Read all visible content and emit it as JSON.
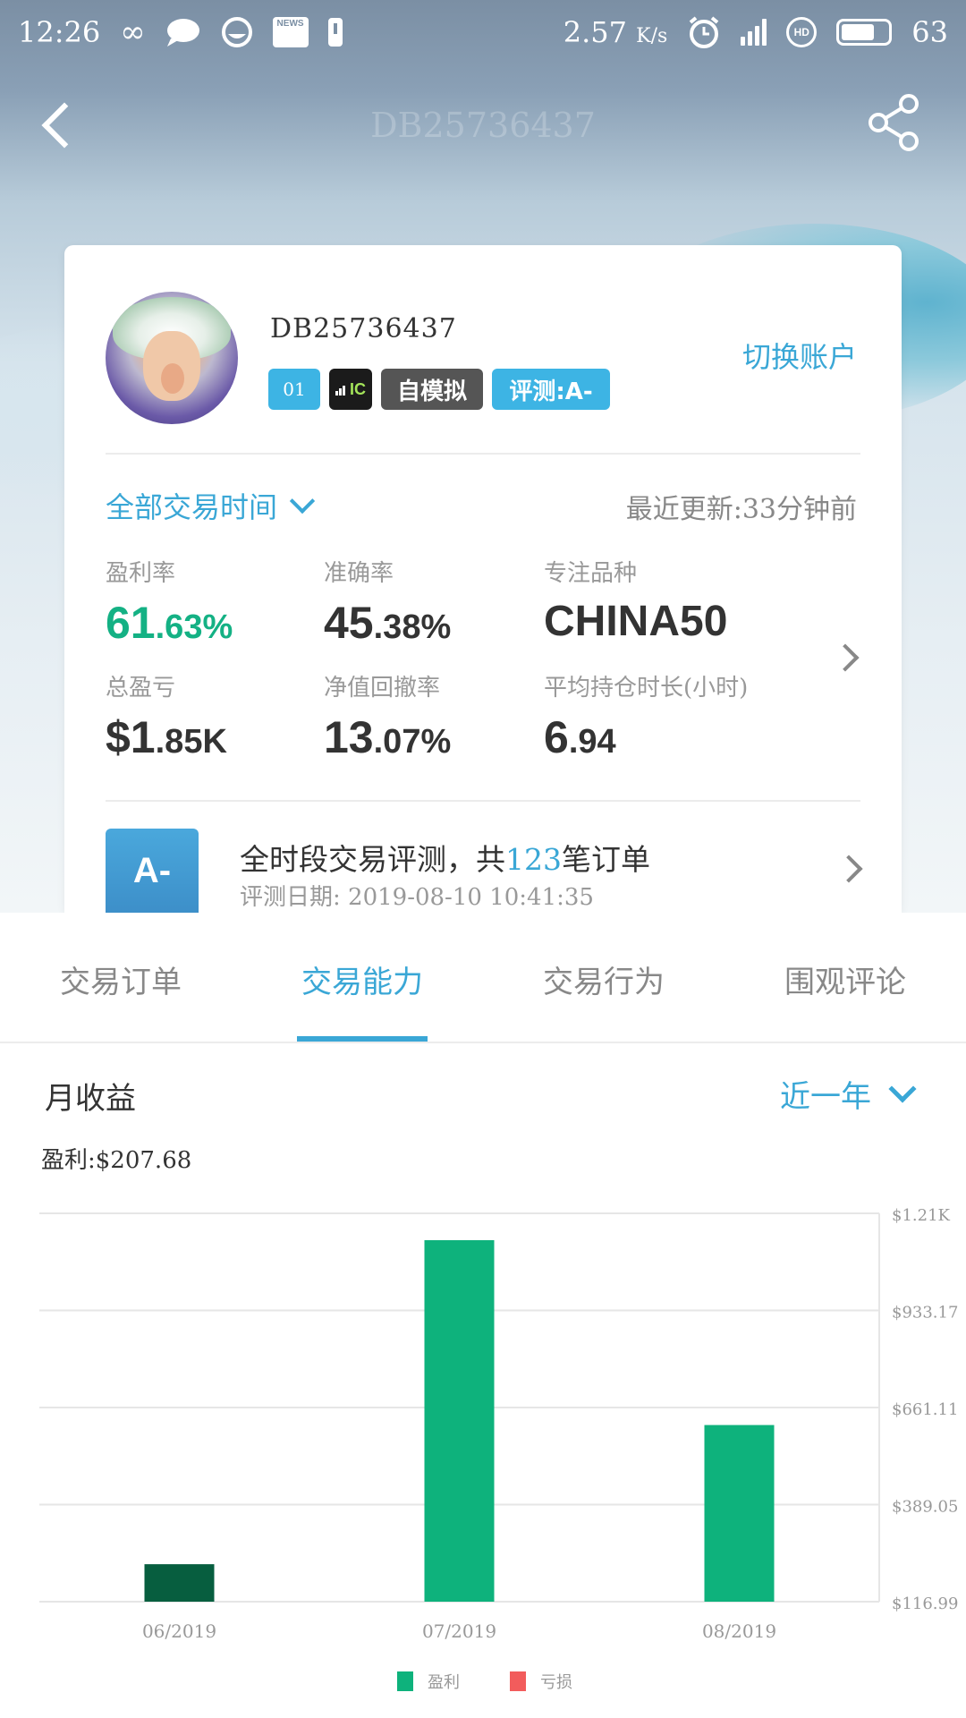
{
  "status_bar": {
    "time": "12:26",
    "news_label": "NEWS",
    "net_speed": "2.57",
    "net_unit": "K/s",
    "network": "4G",
    "hd": "HD",
    "battery": "63"
  },
  "nav": {
    "title": "DB25736437"
  },
  "profile": {
    "account_id": "DB25736437",
    "level_badge": "01",
    "ic_badge": "IC",
    "sim_badge": "自模拟",
    "eval_badge": "评测:A-",
    "switch_account": "切换账户",
    "time_filter": "全部交易时间",
    "last_update": "最近更新:33分钟前"
  },
  "stats": {
    "profit_rate": {
      "label": "盈利率",
      "int": "61",
      "dec": ".63%"
    },
    "accuracy": {
      "label": "准确率",
      "int": "45",
      "dec": ".38%"
    },
    "focus_symbol": {
      "label": "专注品种",
      "value": "CHINA50"
    },
    "total_pl": {
      "label": "总盈亏",
      "int": "$1",
      "dec": ".85K"
    },
    "drawdown": {
      "label": "净值回撤率",
      "int": "13",
      "dec": ".07%"
    },
    "avg_hold": {
      "label": "平均持仓时长(小时)",
      "int": "6",
      "dec": ".94"
    }
  },
  "evaluation": {
    "grade": "A-",
    "title_prefix": "全时段交易评测，共",
    "order_count": "123",
    "title_suffix": "笔订单",
    "date": "评测日期: 2019-08-10 10:41:35"
  },
  "tabs": [
    {
      "label": "交易订单"
    },
    {
      "label": "交易能力"
    },
    {
      "label": "交易行为"
    },
    {
      "label": "围观评论"
    }
  ],
  "monthly": {
    "title": "月收益",
    "range": "近一年",
    "profit_summary": "盈利:$207.68"
  },
  "chart_data": {
    "type": "bar",
    "categories": [
      "06/2019",
      "07/2019",
      "08/2019"
    ],
    "series": [
      {
        "name": "盈利",
        "values": [
          222,
          1130,
          612
        ]
      }
    ],
    "bar_colors": [
      "#075e3f",
      "#0eb27c",
      "#0eb27c"
    ],
    "y_tick_labels": [
      "$1.21K",
      "$933.17",
      "$661.11",
      "$389.05",
      "$116.99"
    ],
    "y_ticks": [
      1205.23,
      933.17,
      661.11,
      389.05,
      116.99
    ],
    "ylim": [
      116.99,
      1205.23
    ],
    "grid": true,
    "legend": [
      {
        "label": "盈利",
        "color": "#0eb27c"
      },
      {
        "label": "亏损",
        "color": "#f25c5c"
      }
    ],
    "legend_position": "bottom"
  },
  "colors": {
    "accent": "#3aa7d6",
    "green": "#14b184"
  }
}
